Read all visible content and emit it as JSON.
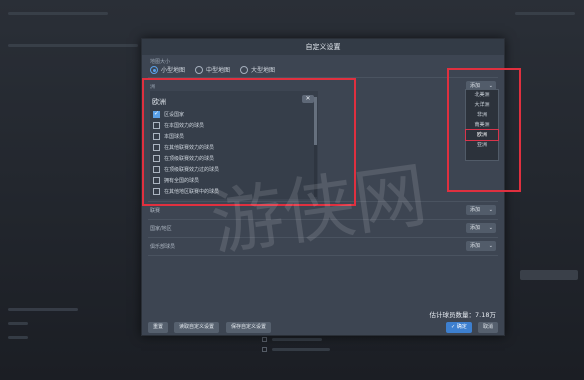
{
  "dialog": {
    "title": "自定义设置"
  },
  "map_size": {
    "label": "地图大小",
    "options": [
      "小型地图",
      "中型地图",
      "大型地图"
    ],
    "selected": 0
  },
  "region": {
    "label": "洲",
    "add_label": "添加",
    "title": "欧洲",
    "delete_symbol": "✕",
    "items": [
      {
        "label": "区设国家",
        "checked": true
      },
      {
        "label": "在本国效力的球员",
        "checked": false
      },
      {
        "label": "本国球员",
        "checked": false
      },
      {
        "label": "在其他联赛效力的球员",
        "checked": false
      },
      {
        "label": "在顶级联赛效力的球员",
        "checked": false
      },
      {
        "label": "在顶级联赛效力过的球员",
        "checked": false
      },
      {
        "label": "拥有全国的球员",
        "checked": false
      },
      {
        "label": "在其他地区联赛中的球员",
        "checked": false
      }
    ]
  },
  "continent_menu": {
    "items": [
      "北美洲",
      "大洋洲",
      "非洲",
      "南美洲",
      "欧洲",
      "亚洲"
    ],
    "selected": "欧洲"
  },
  "other_sections": [
    {
      "label": "联赛",
      "add_label": "添加"
    },
    {
      "label": "国家/地区",
      "add_label": "添加"
    },
    {
      "label": "俱乐部球员",
      "add_label": "添加"
    }
  ],
  "summary": {
    "count_text": "估计球员数量：7.18万"
  },
  "buttons": {
    "reset": "重置",
    "load": "读取自定义设置",
    "save": "保存自定义设置",
    "ok": "✓ 确定",
    "cancel": "取消"
  },
  "watermark": "游侠网",
  "colors": {
    "accent": "#5aa0e8",
    "highlight": "#e0303f",
    "dialog_bg": "#3d4552"
  }
}
